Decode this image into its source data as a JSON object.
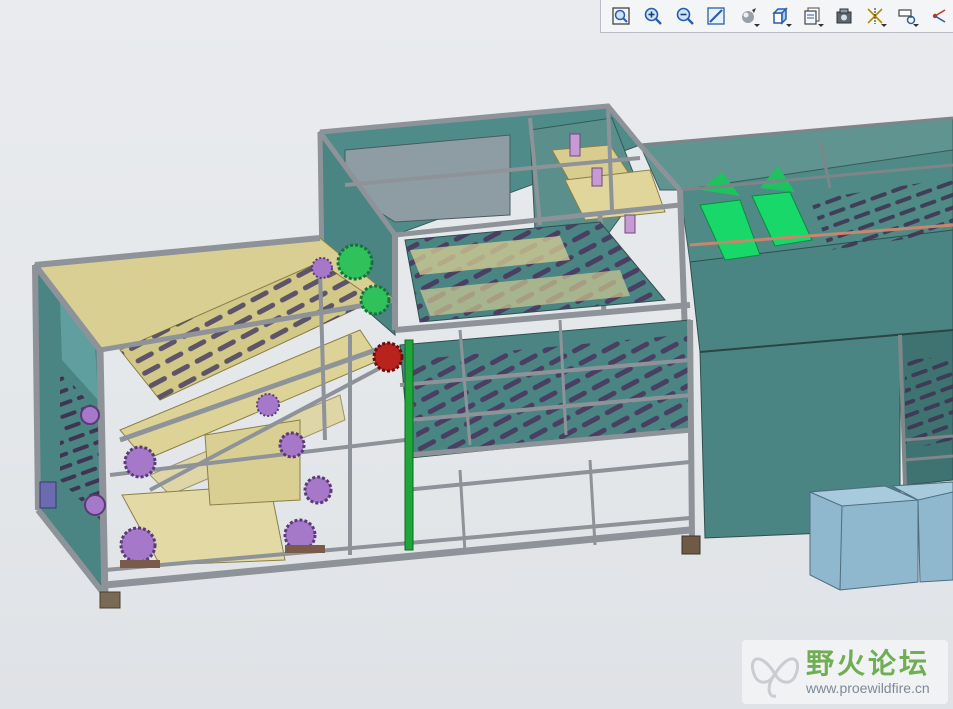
{
  "toolbar": {
    "buttons": [
      {
        "icon": "zoom-fit-icon"
      },
      {
        "icon": "zoom-in-icon"
      },
      {
        "icon": "zoom-out-icon"
      },
      {
        "icon": "repaint-icon"
      },
      {
        "icon": "display-style-icon"
      },
      {
        "icon": "saved-views-icon"
      },
      {
        "icon": "layers-icon"
      },
      {
        "icon": "appearance-icon"
      },
      {
        "icon": "datum-display-icon"
      },
      {
        "icon": "annotation-display-icon"
      },
      {
        "icon": "spin-center-icon"
      }
    ]
  },
  "watermark": {
    "title": "野火论坛",
    "url": "www.proewildfire.cn"
  },
  "colors": {
    "background": "#e6e8eb",
    "frame": "#8d9399",
    "teal_panel": "#4a8583",
    "tan_panel": "#d9cf93",
    "roller": "#4a3f63",
    "gear_purple": "#a678c9",
    "gear_green": "#31c15a",
    "gear_red": "#b8231e",
    "green_belt": "#18d86a",
    "green_pole": "#1fa53a",
    "bin": "#8fb8cf"
  }
}
